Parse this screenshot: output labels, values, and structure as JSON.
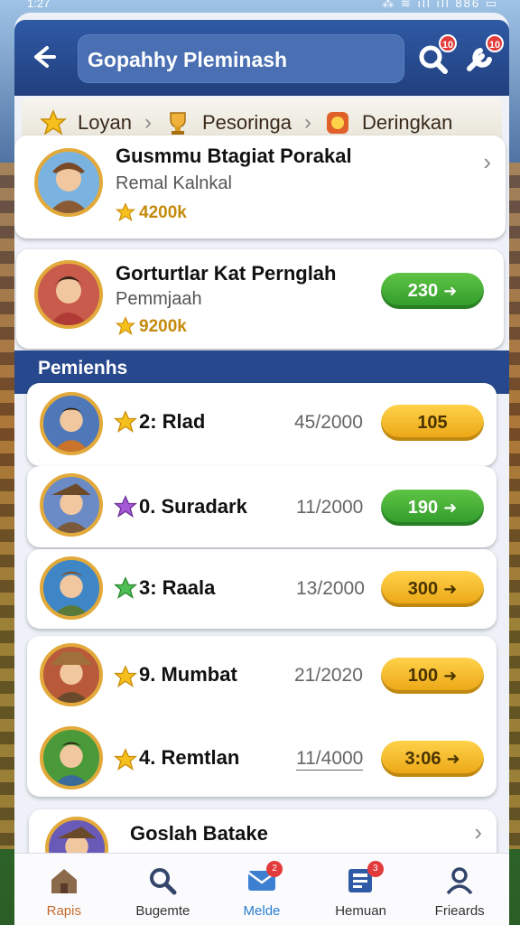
{
  "status": {
    "time": "1:27",
    "right": "⁂ ≋ ıll ıll 886 ▭"
  },
  "header": {
    "search_value": "Gopahhy Pleminash",
    "search_badge": "10",
    "settings_badge": "10"
  },
  "breadcrumb": {
    "items": [
      {
        "label": "Loyan"
      },
      {
        "label": "Pesoringa"
      },
      {
        "label": "Deringkan"
      }
    ]
  },
  "top_cards": [
    {
      "name": "Gusmmu Btagiat Porakal",
      "sub": "Remal Kalnkal",
      "points": "4200k"
    },
    {
      "name": "Gorturtlar Kat Pernglah",
      "sub": "Pemmjaah",
      "points": "9200k",
      "button": "230"
    }
  ],
  "section_title": "Pemienhs",
  "rows": [
    {
      "rank_name": "2: Rlad",
      "score": "45/2000",
      "button": "105"
    },
    {
      "rank_name": "0. Suradark",
      "score": "11/2000",
      "button": "190"
    },
    {
      "rank_name": "3: Raala",
      "score": "13/2000",
      "button": "300"
    },
    {
      "rank_name": "9. Mumbat",
      "score": "21/2020",
      "button": "100"
    },
    {
      "rank_name": "4. Remtlan",
      "score": "11/4000",
      "button": "3:06"
    }
  ],
  "bottom_card": {
    "name": "Goslah Batake"
  },
  "nav": [
    {
      "label": "Rapis"
    },
    {
      "label": "Bugemte"
    },
    {
      "label": "Melde",
      "badge": "2"
    },
    {
      "label": "Hemuan",
      "badge": "3"
    },
    {
      "label": "Frieards"
    }
  ],
  "colors": {
    "header": "#2f5aa5",
    "section": "#27488c",
    "green": "#2f9a2b",
    "gold": "#eaa412",
    "badge": "#e23b3b"
  }
}
